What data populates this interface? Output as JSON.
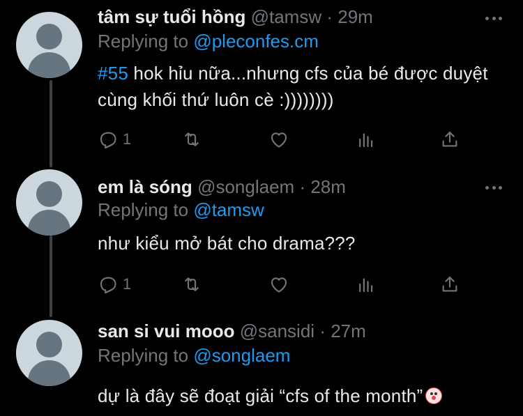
{
  "tweets": [
    {
      "name": "tâm sự tuổi hồng",
      "handle": "@tamsw",
      "dot": "·",
      "time": "29m",
      "replying_label": "Replying to",
      "replying_to": "@pleconfes.cm",
      "hashtag": "#55",
      "text": " hok hỉu nữa...nhưng cfs của bé được duyệt cùng khối thứ luôn cè :))))))))",
      "reply_count": "1",
      "retweet_count": "",
      "like_count": ""
    },
    {
      "name": "em là sóng",
      "handle": "@songlaem",
      "dot": "·",
      "time": "28m",
      "replying_label": "Replying to",
      "replying_to": "@tamsw",
      "text": "như kiểu mở bát cho drama???",
      "reply_count": "1",
      "retweet_count": "",
      "like_count": ""
    },
    {
      "name": "san si vui mooo",
      "handle": "@sansidi",
      "dot": "·",
      "time": "27m",
      "replying_label": "Replying to",
      "replying_to": "@songlaem",
      "text": "dự là đây sẽ đoạt giải “cfs of the month”",
      "emoji": "clown-face-emoji"
    }
  ],
  "icons": {
    "reply": "reply-icon",
    "retweet": "retweet-icon",
    "like": "heart-icon",
    "analytics": "analytics-icon",
    "share": "share-icon",
    "more": "more-icon"
  },
  "colors": {
    "background": "#000000",
    "text": "#e7e9ea",
    "muted": "#71767b",
    "accent": "#1d9bf0",
    "thread_line": "#3e4144",
    "avatar_bg": "#ccd6dd",
    "avatar_fg": "#66757f"
  }
}
